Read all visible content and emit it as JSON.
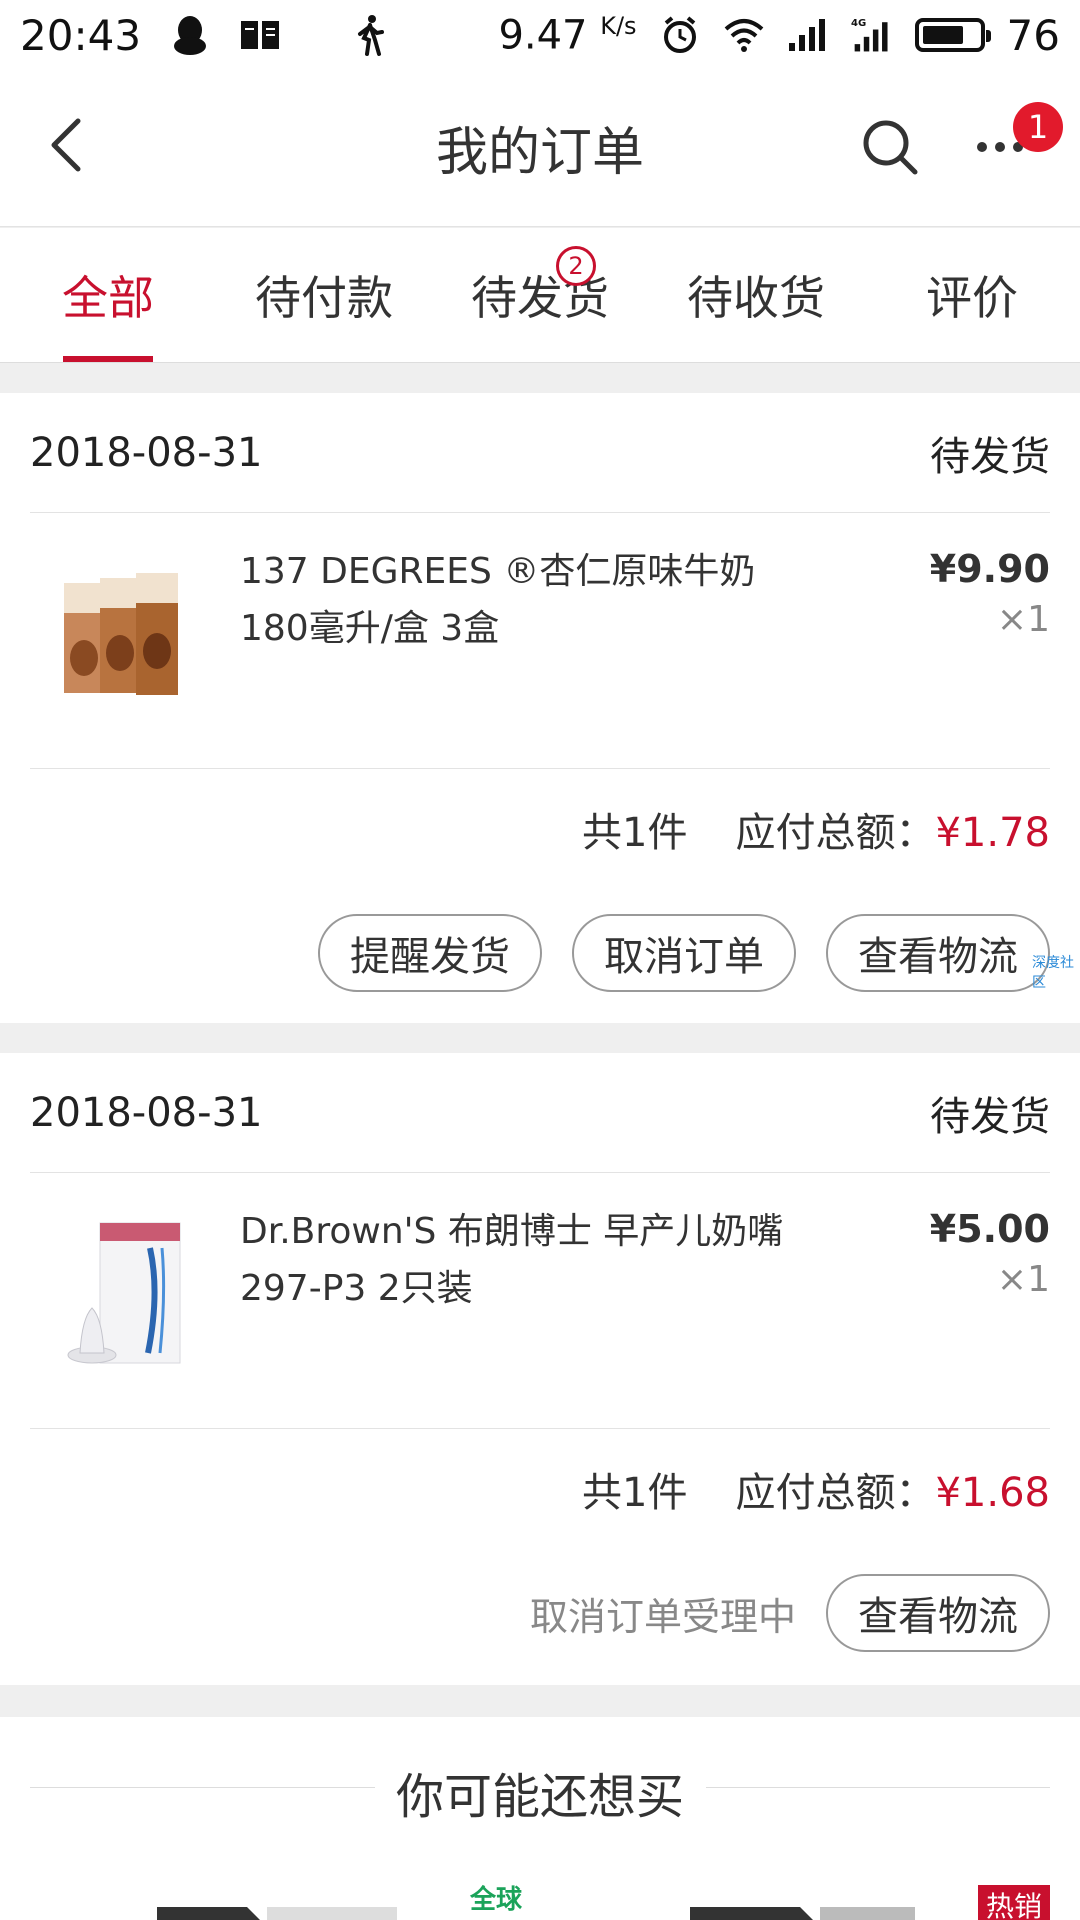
{
  "status_bar": {
    "time": "20:43",
    "speed": "9.47",
    "speed_unit": "K/s",
    "network": "4G",
    "battery": "76",
    "icons": [
      "qq-icon",
      "book-icon",
      "walking-icon",
      "alarm-icon",
      "wifi-icon",
      "signal-icon",
      "signal-4g-icon",
      "battery-icon"
    ]
  },
  "header": {
    "title": "我的订单",
    "more_badge": "1"
  },
  "tabs": [
    {
      "label": "全部",
      "active": true
    },
    {
      "label": "待付款"
    },
    {
      "label": "待发货",
      "badge": "2"
    },
    {
      "label": "待收货"
    },
    {
      "label": "评价"
    }
  ],
  "orders": [
    {
      "date": "2018-08-31",
      "status": "待发货",
      "product_name": "137 DEGREES ®杏仁原味牛奶 180毫升/盒 3盒",
      "price": "¥9.90",
      "qty": "×1",
      "count_text": "共1件",
      "total_label": "应付总额：",
      "total": "¥1.78",
      "buttons": [
        "提醒发货",
        "取消订单",
        "查看物流"
      ]
    },
    {
      "date": "2018-08-31",
      "status": "待发货",
      "product_name": "Dr.Brown'S 布朗博士 早产儿奶嘴 297-P3 2只装",
      "price": "¥5.00",
      "qty": "×1",
      "count_text": "共1件",
      "total_label": "应付总额：",
      "total": "¥1.68",
      "note": "取消订单受理中",
      "buttons": [
        "查看物流"
      ]
    }
  ],
  "watermark": "深度社区",
  "recommend": {
    "title": "你可能还想买",
    "tag_green": "全球",
    "tag_hot": "热销"
  },
  "colors": {
    "accent": "#c8102e",
    "badge": "#e21a2c",
    "background": "#efefef"
  }
}
